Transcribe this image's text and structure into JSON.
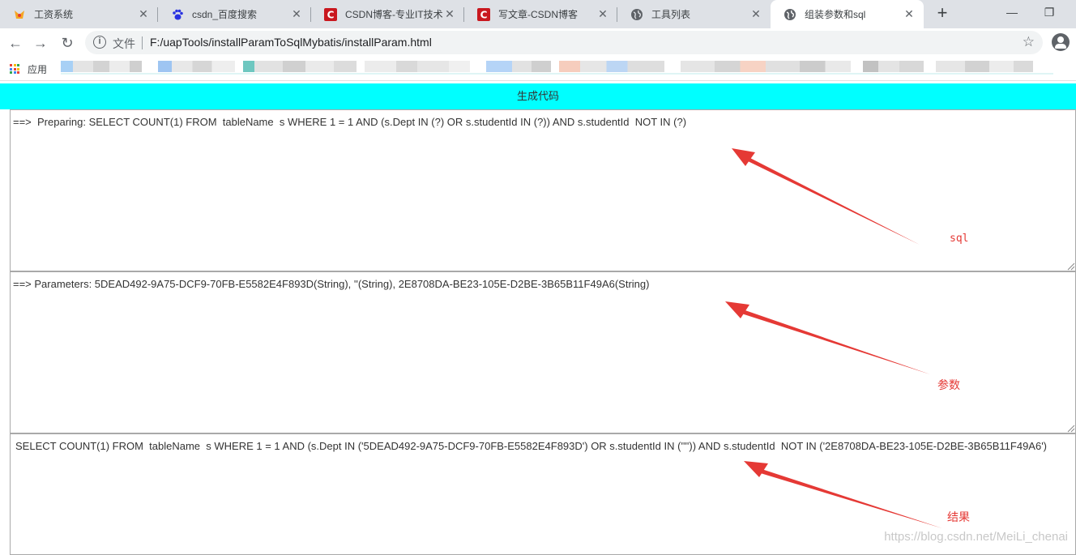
{
  "browser": {
    "tabs": [
      {
        "title": "工资系统",
        "icon": "payroll-icon",
        "active": false
      },
      {
        "title": "csdn_百度搜索",
        "icon": "baidu-paw-icon",
        "active": false
      },
      {
        "title": "CSDN博客-专业IT技术",
        "icon": "csdn-logo-icon",
        "active": false
      },
      {
        "title": "写文章-CSDN博客",
        "icon": "csdn-logo-icon",
        "active": false
      },
      {
        "title": "工具列表",
        "icon": "globe-icon",
        "active": false
      },
      {
        "title": "组装参数和sql",
        "icon": "globe-icon",
        "active": true
      }
    ],
    "omnibox": {
      "scheme_label": "文件",
      "url": "F:/uapTools/installParamToSqlMybatis/installParam.html"
    },
    "bookmarks": {
      "apps_label": "应用"
    }
  },
  "page": {
    "generate_button": "生成代码",
    "sql_input": "==>  Preparing: SELECT COUNT(1) FROM  tableName  s WHERE 1 = 1 AND (s.Dept IN (?) OR s.studentId IN (?)) AND s.studentId  NOT IN (?)",
    "params_input": "==> Parameters: 5DEAD492-9A75-DCF9-70FB-E5582E4F893D(String), ''(String), 2E8708DA-BE23-105E-D2BE-3B65B11F49A6(String)",
    "result_output": "SELECT COUNT(1) FROM  tableName  s WHERE 1 = 1 AND (s.Dept IN ('5DEAD492-9A75-DCF9-70FB-E5582E4F893D') OR s.studentId IN ('''')) AND s.studentId  NOT IN ('2E8708DA-BE23-105E-D2BE-3B65B11F49A6')"
  },
  "annotations": {
    "sql_label": "sql",
    "params_label": "参数",
    "result_label": "结果",
    "color": "#e53935"
  },
  "watermark": "https://blog.csdn.net/MeiLi_chenai"
}
